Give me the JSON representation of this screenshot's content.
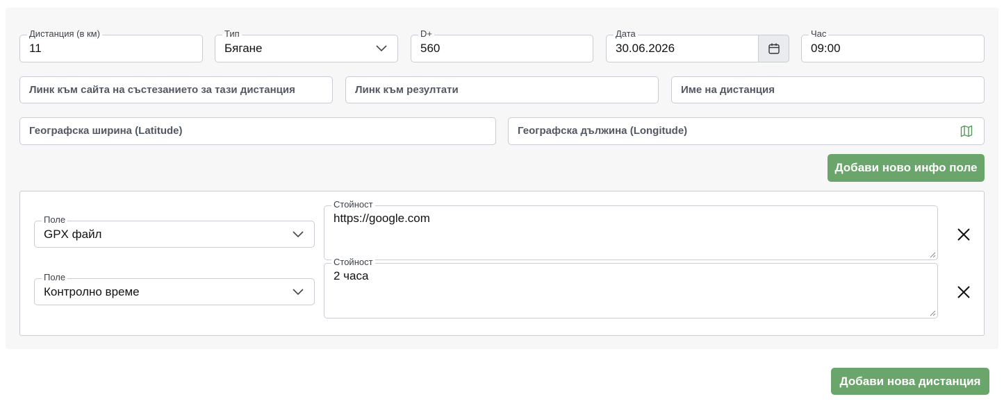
{
  "distance": {
    "label": "Дистанция (в км)",
    "value": "11"
  },
  "type": {
    "label": "Тип",
    "value": "Бягане"
  },
  "elevation": {
    "label": "D+",
    "value": "560"
  },
  "date": {
    "label": "Дата",
    "value": "30.06.2026"
  },
  "time": {
    "label": "Час",
    "value": "09:00"
  },
  "links": {
    "competition_site_placeholder": "Линк към сайта на състезанието за тази дистанция",
    "results_placeholder": "Линк към резултати",
    "distance_name_placeholder": "Име на дистанция"
  },
  "coords": {
    "latitude_placeholder": "Географска ширина (Latitude)",
    "longitude_placeholder": "Географска дължина (Longitude)"
  },
  "add_info_button": "Добави ново инфо поле",
  "info_fields": [
    {
      "field_label": "Поле",
      "field_value": "GPX файл",
      "value_label": "Стойност",
      "value": "https://google.com"
    },
    {
      "field_label": "Поле",
      "field_value": "Контролно време",
      "value_label": "Стойност",
      "value": "2 часа"
    }
  ],
  "add_distance_button": "Добави нова дистанция",
  "colors": {
    "accent_green": "#6aa56b",
    "panel_bg": "#f7f7f8",
    "border": "#c9ccd3"
  }
}
